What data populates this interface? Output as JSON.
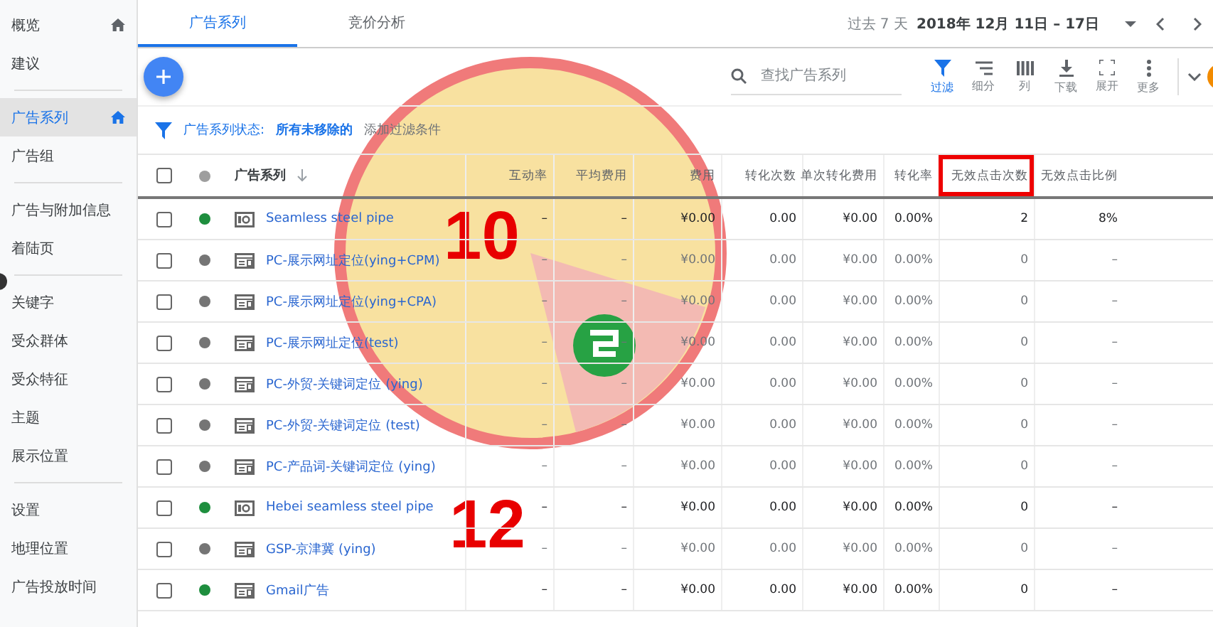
{
  "sidebar": {
    "groups": [
      {
        "items": [
          {
            "label": "概览",
            "selected": false,
            "home": true
          },
          {
            "label": "建议",
            "selected": false,
            "home": false
          }
        ]
      },
      {
        "items": [
          {
            "label": "广告系列",
            "selected": true,
            "home": true
          },
          {
            "label": "广告组",
            "selected": false,
            "home": false
          }
        ]
      },
      {
        "items": [
          {
            "label": "广告与附加信息",
            "selected": false,
            "home": false
          },
          {
            "label": "着陆页",
            "selected": false,
            "home": false
          }
        ]
      },
      {
        "items": [
          {
            "label": "关键字",
            "selected": false,
            "home": false
          },
          {
            "label": "受众群体",
            "selected": false,
            "home": false
          },
          {
            "label": "受众特征",
            "selected": false,
            "home": false
          },
          {
            "label": "主题",
            "selected": false,
            "home": false
          },
          {
            "label": "展示位置",
            "selected": false,
            "home": false
          }
        ]
      },
      {
        "items": [
          {
            "label": "设置",
            "selected": false,
            "home": false
          },
          {
            "label": "地理位置",
            "selected": false,
            "home": false
          },
          {
            "label": "广告投放时间",
            "selected": false,
            "home": false
          }
        ]
      }
    ]
  },
  "tabs": [
    {
      "label": "广告系列",
      "selected": true
    },
    {
      "label": "竞价分析",
      "selected": false
    }
  ],
  "date_range": {
    "preset": "过去 7 天",
    "range": "2018年 12月 11日 – 17日"
  },
  "search": {
    "placeholder": "查找广告系列"
  },
  "toolbar": [
    {
      "kind": "filter",
      "label": "过滤",
      "selected": true
    },
    {
      "kind": "segment",
      "label": "细分",
      "selected": false
    },
    {
      "kind": "columns",
      "label": "列",
      "selected": false
    },
    {
      "kind": "download",
      "label": "下载",
      "selected": false
    },
    {
      "kind": "expand",
      "label": "展开",
      "selected": false
    },
    {
      "kind": "more",
      "label": "更多",
      "selected": false
    }
  ],
  "filter_bar": {
    "label": "广告系列状态:",
    "value": "所有未移除的",
    "add": "添加过滤条件"
  },
  "table": {
    "name_column": "广告系列",
    "all_checked": false,
    "columns": [
      {
        "label": "互动率",
        "highlighted": false
      },
      {
        "label": "平均费用",
        "highlighted": false
      },
      {
        "label": "费用",
        "highlighted": false
      },
      {
        "label": "转化次数",
        "highlighted": false
      },
      {
        "label": "单次转化费用",
        "highlighted": false
      },
      {
        "label": "转化率",
        "highlighted": false
      },
      {
        "label": "无效点击次数",
        "highlighted": true
      },
      {
        "label": "无效点击比例",
        "highlighted": false
      }
    ],
    "rows": [
      {
        "checked": false,
        "color": "#1e8e3e",
        "kind": "video",
        "dimmed": false,
        "name": "Seamless steel pipe",
        "cells": [
          "–",
          "–",
          "¥0.00",
          "0.00",
          "¥0.00",
          "0.00%",
          "2",
          "8%"
        ]
      },
      {
        "checked": false,
        "color": "#757575",
        "kind": "display",
        "dimmed": true,
        "name": "PC-展示网址定位(ying+CPM)",
        "cells": [
          "–",
          "–",
          "¥0.00",
          "0.00",
          "¥0.00",
          "0.00%",
          "0",
          "–"
        ]
      },
      {
        "checked": false,
        "color": "#757575",
        "kind": "display",
        "dimmed": true,
        "name": "PC-展示网址定位(ying+CPA)",
        "cells": [
          "–",
          "–",
          "¥0.00",
          "0.00",
          "¥0.00",
          "0.00%",
          "0",
          "–"
        ]
      },
      {
        "checked": false,
        "color": "#757575",
        "kind": "display",
        "dimmed": true,
        "name": "PC-展示网址定位(test)",
        "cells": [
          "–",
          "–",
          "¥0.00",
          "0.00",
          "¥0.00",
          "0.00%",
          "0",
          "–"
        ]
      },
      {
        "checked": false,
        "color": "#757575",
        "kind": "display",
        "dimmed": true,
        "name": "PC-外贸-关键词定位 (ying)",
        "cells": [
          "–",
          "–",
          "¥0.00",
          "0.00",
          "¥0.00",
          "0.00%",
          "0",
          "–"
        ]
      },
      {
        "checked": false,
        "color": "#757575",
        "kind": "display",
        "dimmed": true,
        "name": "PC-外贸-关键词定位 (test)",
        "cells": [
          "–",
          "–",
          "¥0.00",
          "0.00",
          "¥0.00",
          "0.00%",
          "0",
          "–"
        ]
      },
      {
        "checked": false,
        "color": "#757575",
        "kind": "display",
        "dimmed": true,
        "name": "PC-产品词-关键词定位 (ying)",
        "cells": [
          "–",
          "–",
          "¥0.00",
          "0.00",
          "¥0.00",
          "0.00%",
          "0",
          "–"
        ]
      },
      {
        "checked": false,
        "color": "#1e8e3e",
        "kind": "video",
        "dimmed": false,
        "name": "Hebei seamless steel pipe",
        "cells": [
          "–",
          "–",
          "¥0.00",
          "0.00",
          "¥0.00",
          "0.00%",
          "0",
          "–"
        ]
      },
      {
        "checked": false,
        "color": "#757575",
        "kind": "display",
        "dimmed": true,
        "name": "GSP-京津冀 (ying)",
        "cells": [
          "–",
          "–",
          "¥0.00",
          "0.00",
          "¥0.00",
          "0.00%",
          "0",
          "–"
        ]
      },
      {
        "checked": false,
        "color": "#1e8e3e",
        "kind": "display",
        "dimmed": false,
        "name": "Gmail广告",
        "cells": [
          "–",
          "–",
          "¥0.00",
          "0.00",
          "¥0.00",
          "0.00%",
          "0",
          "–"
        ]
      }
    ]
  },
  "overlay": {
    "labels": [
      "10",
      "12"
    ]
  }
}
